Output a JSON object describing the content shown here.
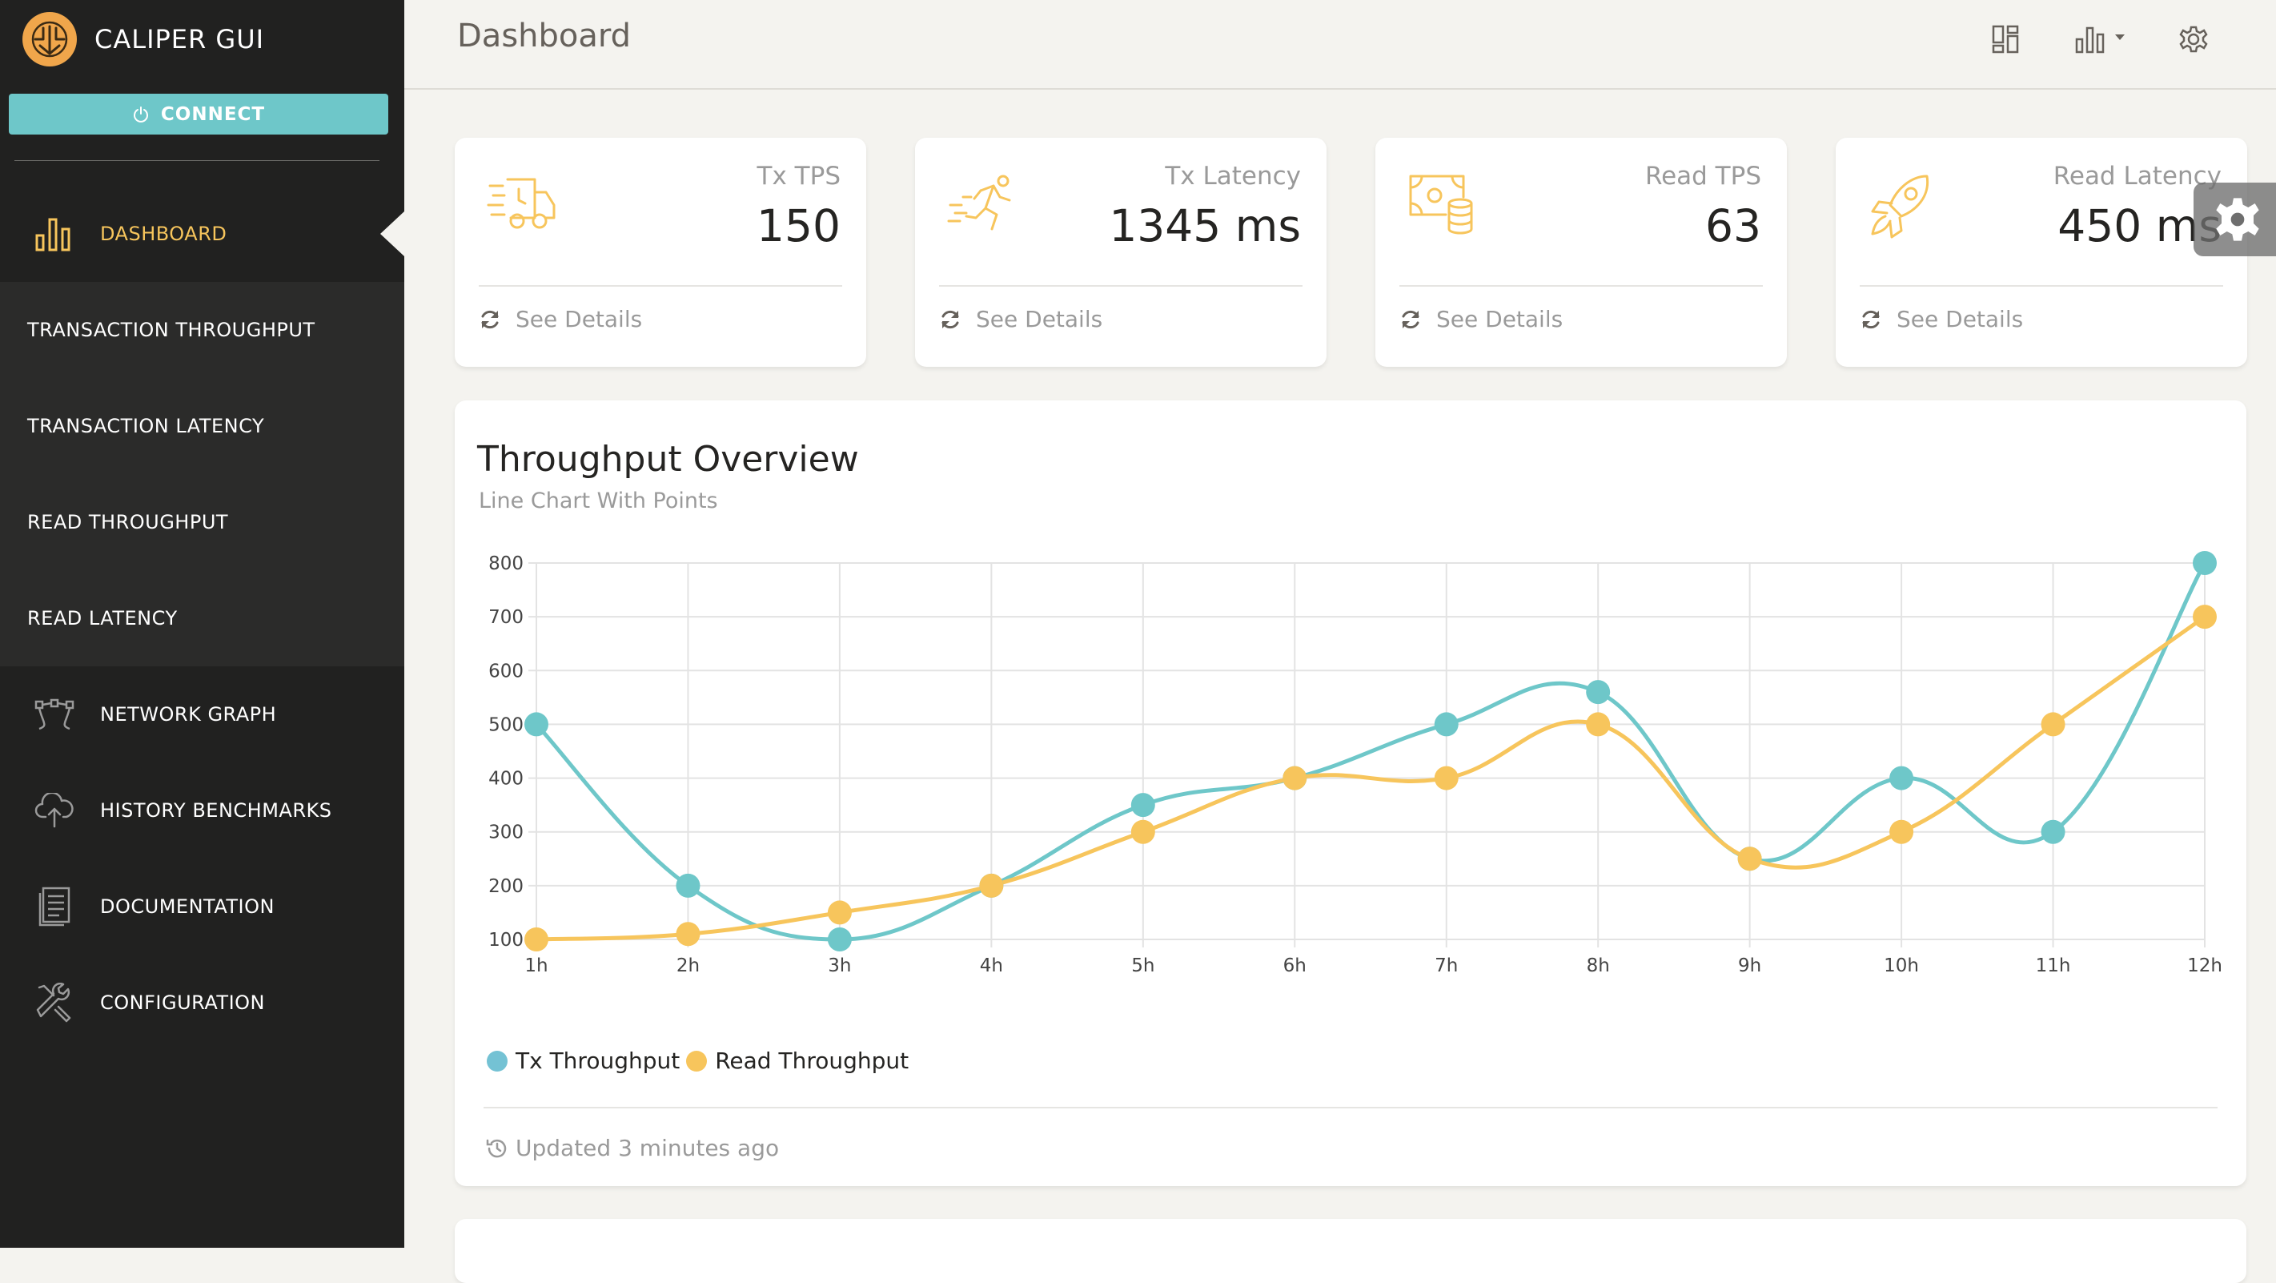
{
  "app": {
    "title": "CALIPER GUI",
    "logo": "caliper-logo"
  },
  "sidebar": {
    "connect_label": "CONNECT",
    "items": [
      {
        "label": "DASHBOARD",
        "icon": "bar-chart-icon",
        "active": true
      },
      {
        "label": "TRANSACTION THROUGHPUT",
        "sub": true
      },
      {
        "label": "TRANSACTION LATENCY",
        "sub": true
      },
      {
        "label": "READ THROUGHPUT",
        "sub": true
      },
      {
        "label": "READ LATENCY",
        "sub": true
      },
      {
        "label": "NETWORK GRAPH",
        "icon": "network-graph-icon"
      },
      {
        "label": "HISTORY BENCHMARKS",
        "icon": "cloud-upload-icon"
      },
      {
        "label": "DOCUMENTATION",
        "icon": "document-icon"
      },
      {
        "label": "CONFIGURATION",
        "icon": "tools-icon"
      }
    ]
  },
  "header": {
    "title": "Dashboard",
    "icons": [
      "layout-grid-icon",
      "bar-chart-dropdown-icon",
      "gear-icon"
    ]
  },
  "stats": [
    {
      "label": "Tx TPS",
      "value": "150",
      "icon": "delivery-truck-icon",
      "footer": "See Details"
    },
    {
      "label": "Tx Latency",
      "value": "1345 ms",
      "icon": "running-person-icon",
      "footer": "See Details"
    },
    {
      "label": "Read TPS",
      "value": "63",
      "icon": "money-coins-icon",
      "footer": "See Details"
    },
    {
      "label": "Read Latency",
      "value": "450 ms",
      "icon": "rocket-icon",
      "footer": "See Details"
    }
  ],
  "chart": {
    "title": "Throughput Overview",
    "subtitle": "Line Chart With Points",
    "footer": "Updated 3 minutes ago"
  },
  "chart_data": {
    "type": "line",
    "x": [
      "1h",
      "2h",
      "3h",
      "4h",
      "5h",
      "6h",
      "7h",
      "8h",
      "9h",
      "10h",
      "11h",
      "12h"
    ],
    "series": [
      {
        "name": "Tx Throughput",
        "color": "#6ec7c9",
        "values": [
          500,
          200,
          100,
          200,
          350,
          400,
          500,
          560,
          250,
          400,
          300,
          800
        ]
      },
      {
        "name": "Read Throughput",
        "color": "#f7c55c",
        "values": [
          100,
          110,
          150,
          200,
          300,
          400,
          400,
          500,
          250,
          300,
          500,
          700
        ]
      }
    ],
    "yticks": [
      100,
      200,
      300,
      400,
      500,
      600,
      700,
      800
    ],
    "ylim": [
      100,
      800
    ],
    "grid": true,
    "legend_position": "bottom-left",
    "legend_colors": [
      "#74c2d4",
      "#f7c55c"
    ]
  }
}
